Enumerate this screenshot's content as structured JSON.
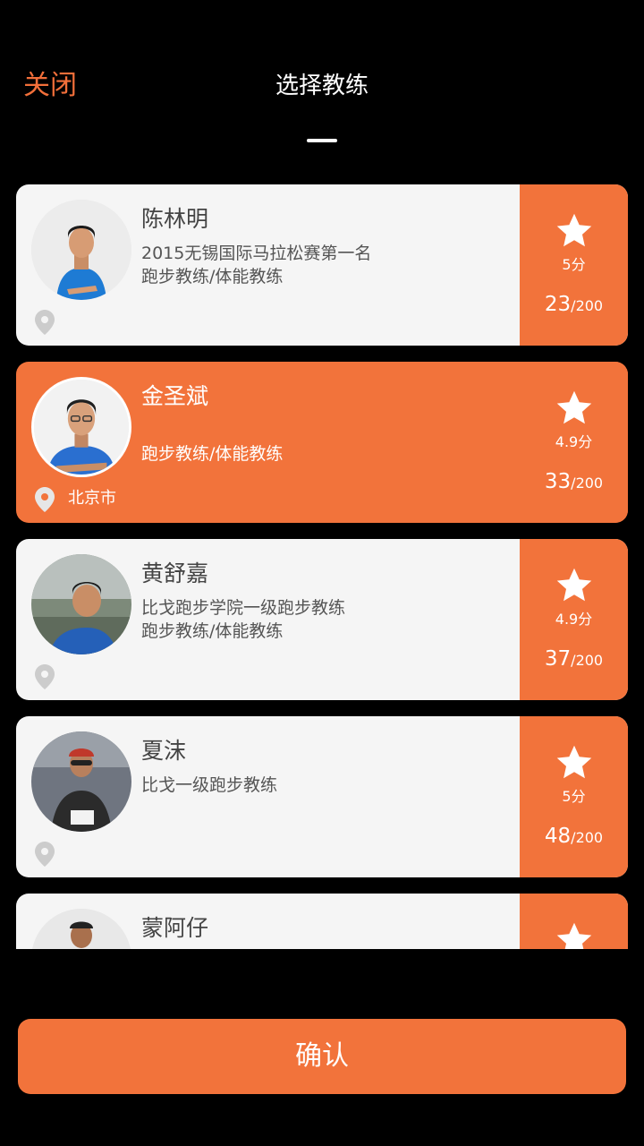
{
  "header": {
    "close_label": "关闭",
    "title": "选择教练"
  },
  "coaches": [
    {
      "name": "陈林明",
      "line1": "2015无锡国际马拉松赛第一名",
      "line2": "跑步教练/体能教练",
      "city": "",
      "rating": "5分",
      "booked": "23",
      "capacity": "/200",
      "selected": false
    },
    {
      "name": "金圣斌",
      "line1": "",
      "line2": "跑步教练/体能教练",
      "city": "北京市",
      "rating": "4.9分",
      "booked": "33",
      "capacity": "/200",
      "selected": true
    },
    {
      "name": "黄舒嘉",
      "line1": "比戈跑步学院一级跑步教练",
      "line2": "跑步教练/体能教练",
      "city": "",
      "rating": "4.9分",
      "booked": "37",
      "capacity": "/200",
      "selected": false
    },
    {
      "name": "夏沫",
      "line1": "比戈一级跑步教练",
      "line2": "",
      "city": "",
      "rating": "5分",
      "booked": "48",
      "capacity": "/200",
      "selected": false
    },
    {
      "name": "蒙阿仔",
      "line1": "",
      "line2": "",
      "city": "",
      "rating": "",
      "booked": "",
      "capacity": "",
      "selected": false
    }
  ],
  "confirm_label": "确认",
  "colors": {
    "accent": "#f2733b",
    "card_bg": "#f5f5f5",
    "background": "#000000"
  },
  "icons": {
    "star": "star-icon",
    "pin": "location-pin-icon",
    "avatar": "avatar-photo"
  }
}
